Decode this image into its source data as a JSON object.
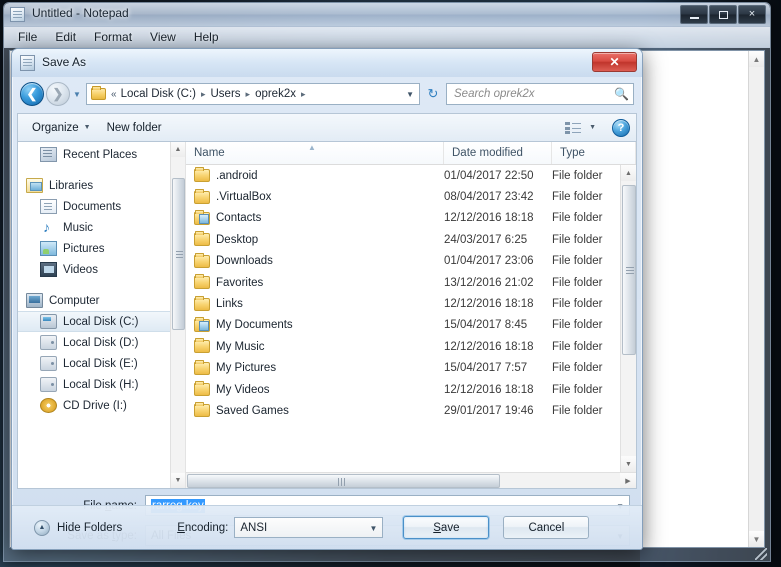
{
  "notepad": {
    "title": "Untitled - Notepad",
    "icon": "notepad-icon",
    "menu": [
      "File",
      "Edit",
      "Format",
      "View",
      "Help"
    ],
    "window_controls": {
      "minimize": "minimize-icon",
      "maximize": "maximize-icon",
      "close": "×"
    }
  },
  "dialog": {
    "title": "Save As",
    "close_label": "✕",
    "navigation": {
      "back": "←",
      "forward": "→",
      "recent_pages": "▼",
      "refresh": "↻"
    },
    "breadcrumb": {
      "chevrons": "«",
      "segments": [
        "Local Disk (C:)",
        "Users",
        "oprek2x"
      ],
      "separator": "▸",
      "dropdown": "▼"
    },
    "search": {
      "placeholder": "Search oprek2x",
      "icon": "search-icon"
    },
    "toolbar": {
      "organize": "Organize",
      "organize_caret": "▼",
      "new_folder": "New folder",
      "view_caret": "▼",
      "help": "?"
    },
    "sidebar": {
      "items": [
        {
          "label": "Recent Places",
          "icon": "recent-places-icon",
          "type": "item"
        },
        {
          "label": "Libraries",
          "icon": "library-icon",
          "type": "header"
        },
        {
          "label": "Documents",
          "icon": "documents-icon",
          "type": "item"
        },
        {
          "label": "Music",
          "icon": "music-icon",
          "type": "item"
        },
        {
          "label": "Pictures",
          "icon": "pictures-icon",
          "type": "item"
        },
        {
          "label": "Videos",
          "icon": "videos-icon",
          "type": "item"
        },
        {
          "label": "Computer",
          "icon": "computer-icon",
          "type": "header"
        },
        {
          "label": "Local Disk (C:)",
          "icon": "system-drive-icon",
          "type": "item",
          "selected": true
        },
        {
          "label": "Local Disk (D:)",
          "icon": "drive-icon",
          "type": "item"
        },
        {
          "label": "Local Disk (E:)",
          "icon": "drive-icon",
          "type": "item"
        },
        {
          "label": "Local Disk (H:)",
          "icon": "drive-icon",
          "type": "item"
        },
        {
          "label": "CD Drive (I:)",
          "icon": "cd-drive-icon",
          "type": "item"
        }
      ]
    },
    "file_list": {
      "columns": [
        "Name",
        "Date modified",
        "Type"
      ],
      "sort_arrow": "▲",
      "rows": [
        {
          "name": ".android",
          "date": "01/04/2017 22:50",
          "type": "File folder",
          "icon": "folder-icon"
        },
        {
          "name": ".VirtualBox",
          "date": "08/04/2017 23:42",
          "type": "File folder",
          "icon": "folder-icon"
        },
        {
          "name": "Contacts",
          "date": "12/12/2016 18:18",
          "type": "File folder",
          "icon": "folder-contacts-icon"
        },
        {
          "name": "Desktop",
          "date": "24/03/2017 6:25",
          "type": "File folder",
          "icon": "folder-desktop-icon"
        },
        {
          "name": "Downloads",
          "date": "01/04/2017 23:06",
          "type": "File folder",
          "icon": "folder-downloads-icon"
        },
        {
          "name": "Favorites",
          "date": "13/12/2016 21:02",
          "type": "File folder",
          "icon": "folder-favorites-icon"
        },
        {
          "name": "Links",
          "date": "12/12/2016 18:18",
          "type": "File folder",
          "icon": "folder-links-icon"
        },
        {
          "name": "My Documents",
          "date": "15/04/2017 8:45",
          "type": "File folder",
          "icon": "folder-documents-icon"
        },
        {
          "name": "My Music",
          "date": "12/12/2016 18:18",
          "type": "File folder",
          "icon": "folder-music-icon"
        },
        {
          "name": "My Pictures",
          "date": "15/04/2017 7:57",
          "type": "File folder",
          "icon": "folder-pictures-icon"
        },
        {
          "name": "My Videos",
          "date": "12/12/2016 18:18",
          "type": "File folder",
          "icon": "folder-videos-icon"
        },
        {
          "name": "Saved Games",
          "date": "29/01/2017 19:46",
          "type": "File folder",
          "icon": "folder-savedgames-icon"
        }
      ]
    },
    "form": {
      "filename_label": "File name:",
      "filename_value": "rarreg.key",
      "savetype_label": "Save as type:",
      "savetype_value": "All Files",
      "caret": "▼"
    },
    "footer": {
      "hide_folders": "Hide Folders",
      "hide_chevron": "▲",
      "encoding_label": "Encoding:",
      "encoding_value": "ANSI",
      "save": "Save",
      "cancel": "Cancel"
    }
  },
  "colors": {
    "selection_blue": "#3399ff",
    "close_red": "#d84b42",
    "accent_blue": "#4a90c8"
  }
}
